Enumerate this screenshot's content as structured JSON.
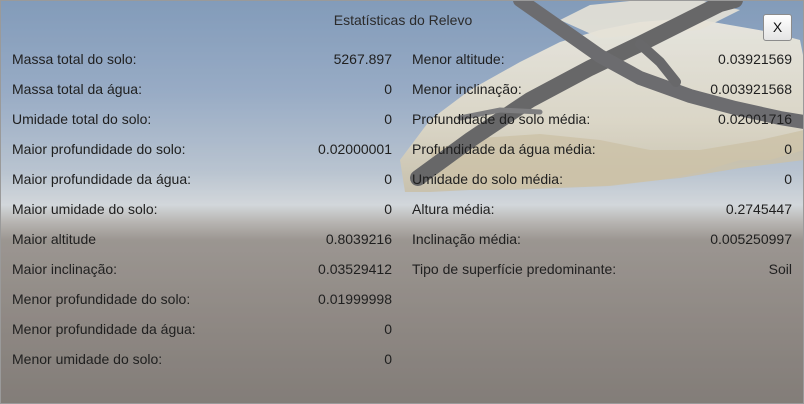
{
  "window": {
    "title": "Estatísticas do Relevo",
    "close_label": "X"
  },
  "left_stats": [
    {
      "label": "Massa total do solo:",
      "value": "5267.897"
    },
    {
      "label": "Massa total da água:",
      "value": "0"
    },
    {
      "label": "Umidade total do solo:",
      "value": "0"
    },
    {
      "label": "Maior profundidade do solo:",
      "value": "0.02000001"
    },
    {
      "label": "Maior profundidade da água:",
      "value": "0"
    },
    {
      "label": "Maior umidade do solo:",
      "value": "0"
    },
    {
      "label": "Maior altitude",
      "value": "0.8039216"
    },
    {
      "label": "Maior inclinação:",
      "value": "0.03529412"
    },
    {
      "label": "Menor profundidade do solo:",
      "value": "0.01999998"
    },
    {
      "label": "Menor profundidade da água:",
      "value": "0"
    },
    {
      "label": "Menor umidade do solo:",
      "value": "0"
    }
  ],
  "right_stats": [
    {
      "label": "Menor altitude:",
      "value": "0.03921569"
    },
    {
      "label": "Menor inclinação:",
      "value": "0.003921568"
    },
    {
      "label": "Profundidade do solo média:",
      "value": "0.02001716"
    },
    {
      "label": "Profundidade da água média:",
      "value": "0"
    },
    {
      "label": "Umidade do solo média:",
      "value": "0"
    },
    {
      "label": "Altura média:",
      "value": "0.2745447"
    },
    {
      "label": "Inclinação média:",
      "value": "0.005250997"
    },
    {
      "label": "Tipo de superfície predominante:",
      "value": "Soil"
    }
  ]
}
